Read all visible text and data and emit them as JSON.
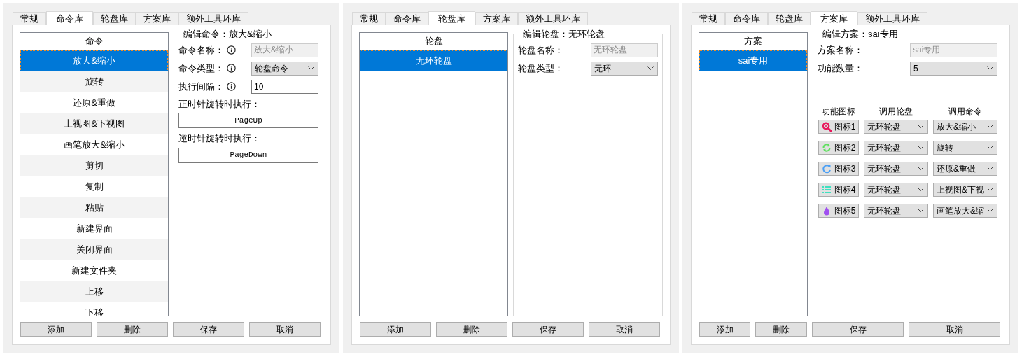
{
  "panels": [
    {
      "kind": "command",
      "tabs": [
        {
          "label": "常规",
          "selected": false
        },
        {
          "label": "命令库",
          "selected": true
        },
        {
          "label": "轮盘库",
          "selected": false
        },
        {
          "label": "方案库",
          "selected": false
        },
        {
          "label": "额外工具环库",
          "selected": false
        }
      ],
      "list": {
        "header": "命令",
        "items": [
          {
            "label": "放大&缩小",
            "selected": true
          },
          {
            "label": "旋转",
            "selected": false
          },
          {
            "label": "还原&重做",
            "selected": false
          },
          {
            "label": "上视图&下视图",
            "selected": false
          },
          {
            "label": "画笔放大&缩小",
            "selected": false
          },
          {
            "label": "剪切",
            "selected": false
          },
          {
            "label": "复制",
            "selected": false
          },
          {
            "label": "粘贴",
            "selected": false
          },
          {
            "label": "新建界面",
            "selected": false
          },
          {
            "label": "关闭界面",
            "selected": false
          },
          {
            "label": "新建文件夹",
            "selected": false
          },
          {
            "label": "上移",
            "selected": false
          },
          {
            "label": "下移",
            "selected": false
          }
        ]
      },
      "editor": {
        "legend": "编辑命令：放大&缩小",
        "fields": [
          {
            "kind": "text",
            "label": "命令名称：",
            "info": true,
            "value": "放大&缩小",
            "disabled": true
          },
          {
            "kind": "select",
            "label": "命令类型：",
            "info": true,
            "value": "轮盘命令"
          },
          {
            "kind": "text",
            "label": "执行间隔：",
            "info": true,
            "value": "10",
            "disabled": false
          }
        ],
        "bindings": [
          {
            "label": "正时针旋转时执行：",
            "key": "PageUp"
          },
          {
            "label": "逆时针旋转时执行：",
            "key": "PageDown"
          }
        ]
      },
      "buttons": [
        "添加",
        "删除",
        "保存",
        "取消"
      ]
    },
    {
      "kind": "wheel",
      "tabs": [
        {
          "label": "常规",
          "selected": false
        },
        {
          "label": "命令库",
          "selected": false
        },
        {
          "label": "轮盘库",
          "selected": true
        },
        {
          "label": "方案库",
          "selected": false
        },
        {
          "label": "额外工具环库",
          "selected": false
        }
      ],
      "list": {
        "header": "轮盘",
        "items": [
          {
            "label": "无环轮盘",
            "selected": true
          }
        ]
      },
      "editor": {
        "legend": "编辑轮盘：无环轮盘",
        "fields": [
          {
            "kind": "text",
            "label": "轮盘名称：",
            "value": "无环轮盘",
            "disabled": true
          },
          {
            "kind": "select",
            "label": "轮盘类型：",
            "value": "无环"
          }
        ]
      },
      "buttons": [
        "添加",
        "删除",
        "保存",
        "取消"
      ]
    },
    {
      "kind": "scheme",
      "tabs": [
        {
          "label": "常规",
          "selected": false
        },
        {
          "label": "命令库",
          "selected": false
        },
        {
          "label": "轮盘库",
          "selected": false
        },
        {
          "label": "方案库",
          "selected": true
        },
        {
          "label": "额外工具环库",
          "selected": false
        }
      ],
      "list": {
        "header": "方案",
        "items": [
          {
            "label": "sai专用",
            "selected": true
          }
        ]
      },
      "editor": {
        "legend": "编辑方案：sai专用",
        "fields": [
          {
            "kind": "text",
            "label": "方案名称：",
            "value": "sai专用",
            "disabled": true
          },
          {
            "kind": "select",
            "label": "功能数量：",
            "value": "5"
          }
        ],
        "table": {
          "columns": [
            "功能图标",
            "调用轮盘",
            "调用命令"
          ],
          "rows": [
            {
              "kind": "magnifier",
              "color": "#e8185c",
              "label": "图标1",
              "wheel": "无环轮盘",
              "command": "放大&缩小"
            },
            {
              "kind": "refresh",
              "color": "#5ee05e",
              "label": "图标2",
              "wheel": "无环轮盘",
              "command": "旋转"
            },
            {
              "kind": "redo",
              "color": "#4a9ff5",
              "label": "图标3",
              "wheel": "无环轮盘",
              "command": "还原&重做"
            },
            {
              "kind": "list",
              "color": "#40e0c0",
              "label": "图标4",
              "wheel": "无环轮盘",
              "command": "上视图&下视"
            },
            {
              "kind": "drop",
              "color": "#a050f0",
              "label": "图标5",
              "wheel": "无环轮盘",
              "command": "画笔放大&缩"
            }
          ]
        }
      },
      "buttons": [
        "添加",
        "删除",
        "保存",
        "取消"
      ]
    }
  ]
}
